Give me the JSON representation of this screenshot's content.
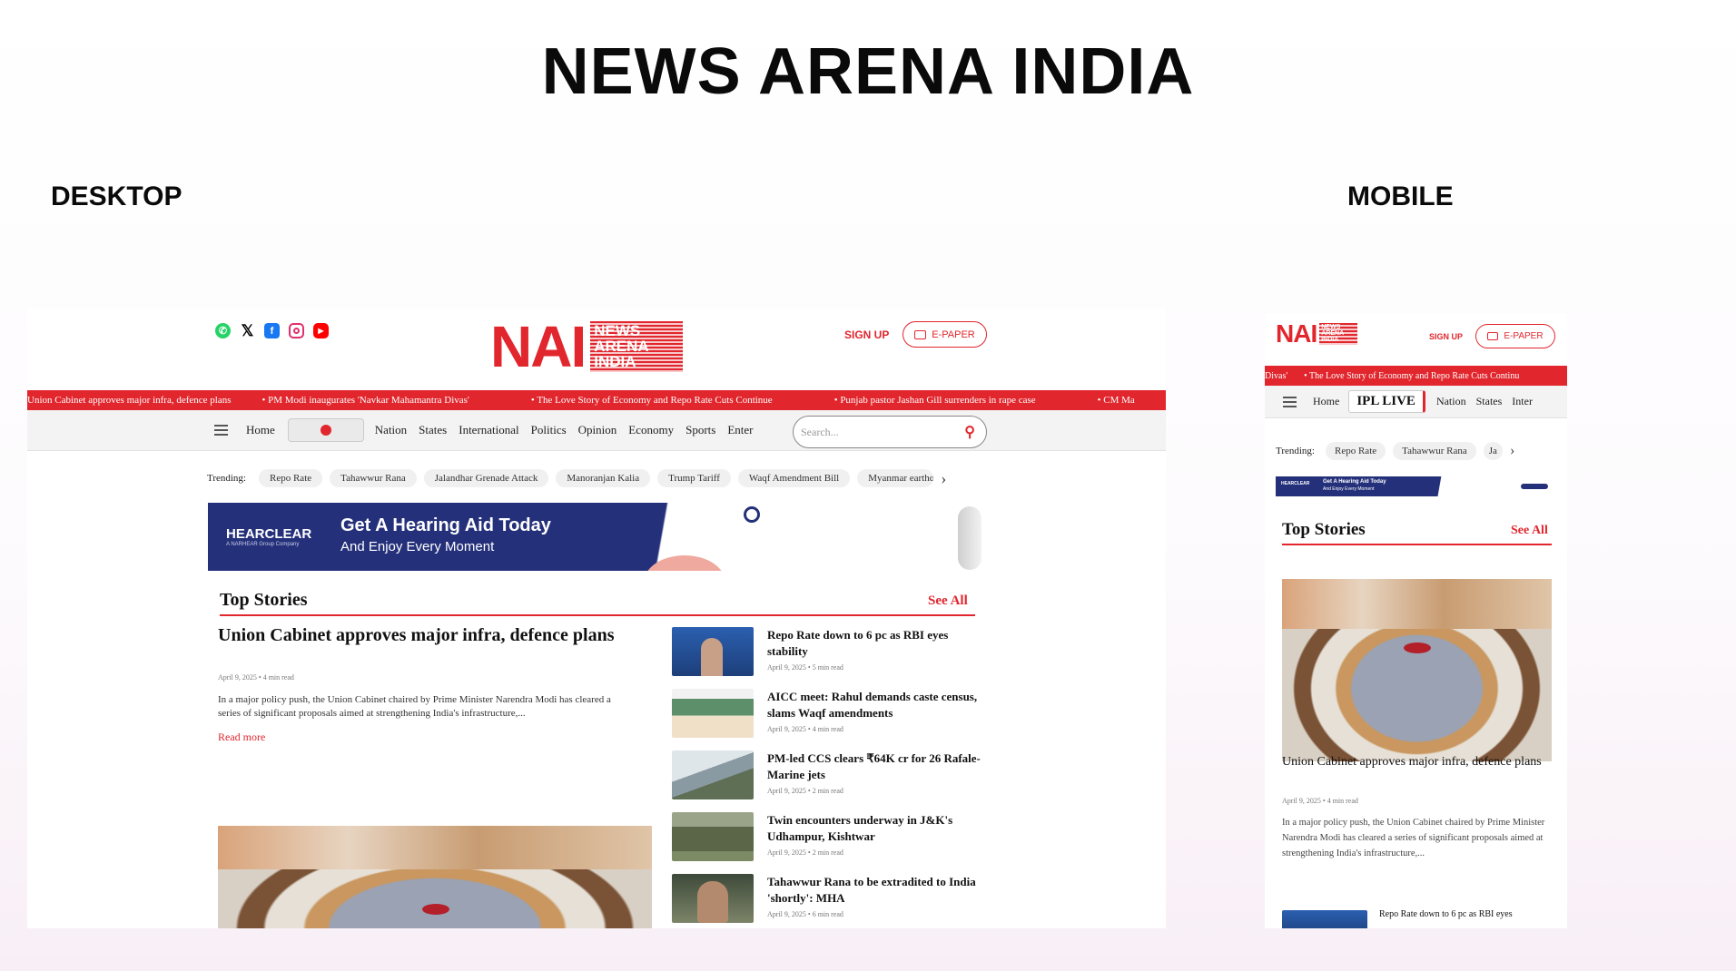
{
  "page": {
    "title": "NEWS ARENA INDIA",
    "desktop_label": "DESKTOP",
    "mobile_label": "MOBILE"
  },
  "brand": {
    "logo_short": "NAI",
    "logo_line1": "NEWS",
    "logo_line2": "ARENA",
    "logo_line3": "INDIA",
    "accent": "#e1262d"
  },
  "header": {
    "social": [
      "whatsapp-icon",
      "x-icon",
      "facebook-icon",
      "instagram-icon",
      "youtube-icon"
    ],
    "sign_up": "SIGN UP",
    "epaper": "E-PAPER"
  },
  "ticker": {
    "items": [
      "Union Cabinet approves major infra, defence plans",
      "PM Modi inaugurates 'Navkar Mahamantra Divas'",
      "The Love Story of Economy and Repo Rate Cuts Continue",
      "Punjab pastor Jashan Gill surrenders in rape case",
      "CM Ma"
    ],
    "mobile_items": [
      "Divas'",
      "The Love Story of Economy and Repo Rate Cuts Continu"
    ]
  },
  "nav": {
    "home": "Home",
    "items": [
      "Nation",
      "States",
      "International",
      "Politics",
      "Opinion",
      "Economy",
      "Sports",
      "Enter"
    ],
    "mobile_badge": "IPL LIVE",
    "mobile_items": [
      "Nation",
      "States",
      "Inter"
    ],
    "search_placeholder": "Search..."
  },
  "trending": {
    "label": "Trending:",
    "items": [
      "Repo Rate",
      "Tahawwur Rana",
      "Jalandhar Grenade Attack",
      "Manoranjan Kalia",
      "Trump Tariff",
      "Waqf Amendment Bill",
      "Myanmar earthq"
    ],
    "mobile_items": [
      "Repo Rate",
      "Tahawwur Rana",
      "Ja"
    ]
  },
  "ad": {
    "brand": "HEARCLEAR",
    "brand_sub": "A NARHEAR Group Company",
    "headline": "Get A Hearing Aid Today",
    "subline": "And Enjoy Every Moment"
  },
  "top_stories": {
    "title": "Top Stories",
    "see_all": "See All",
    "lead": {
      "headline": "Union Cabinet approves major infra, defence plans",
      "meta": "April 9, 2025 • 4 min read",
      "summary": "In a major policy push, the Union Cabinet chaired by Prime Minister Narendra Modi has cleared a series of significant proposals aimed at strengthening India's infrastructure,...",
      "read_more": "Read more"
    },
    "side": [
      {
        "headline": "Repo Rate down to 6 pc as RBI eyes stability",
        "meta": "April 9, 2025 • 5 min read"
      },
      {
        "headline": "AICC meet: Rahul demands caste census, slams Waqf amendments",
        "meta": "April 9, 2025 • 4 min read"
      },
      {
        "headline": "PM-led CCS clears ₹64K cr for 26 Rafale-Marine jets",
        "meta": "April 9, 2025 • 2 min read"
      },
      {
        "headline": "Twin encounters underway in J&K's Udhampur, Kishtwar",
        "meta": "April 9, 2025 • 2 min read"
      },
      {
        "headline": "Tahawwur Rana to be extradited to India 'shortly': MHA",
        "meta": "April 9, 2025 • 6 min read"
      }
    ],
    "mobile_next": "Repo Rate down to 6 pc as RBI eyes"
  }
}
